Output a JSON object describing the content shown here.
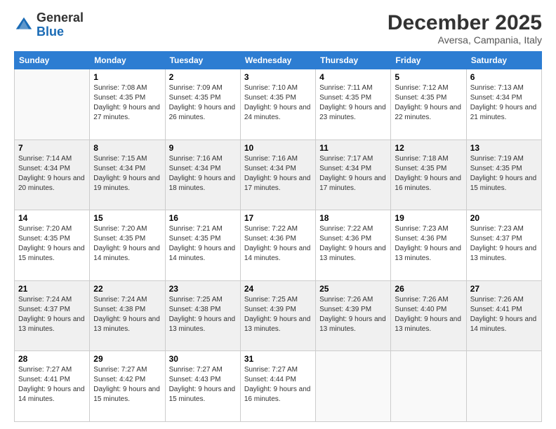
{
  "header": {
    "logo_general": "General",
    "logo_blue": "Blue",
    "month_title": "December 2025",
    "location": "Aversa, Campania, Italy"
  },
  "weekdays": [
    "Sunday",
    "Monday",
    "Tuesday",
    "Wednesday",
    "Thursday",
    "Friday",
    "Saturday"
  ],
  "weeks": [
    [
      {
        "day": null
      },
      {
        "day": 1,
        "sunrise": "7:08 AM",
        "sunset": "4:35 PM",
        "daylight": "9 hours and 27 minutes."
      },
      {
        "day": 2,
        "sunrise": "7:09 AM",
        "sunset": "4:35 PM",
        "daylight": "9 hours and 26 minutes."
      },
      {
        "day": 3,
        "sunrise": "7:10 AM",
        "sunset": "4:35 PM",
        "daylight": "9 hours and 24 minutes."
      },
      {
        "day": 4,
        "sunrise": "7:11 AM",
        "sunset": "4:35 PM",
        "daylight": "9 hours and 23 minutes."
      },
      {
        "day": 5,
        "sunrise": "7:12 AM",
        "sunset": "4:35 PM",
        "daylight": "9 hours and 22 minutes."
      },
      {
        "day": 6,
        "sunrise": "7:13 AM",
        "sunset": "4:34 PM",
        "daylight": "9 hours and 21 minutes."
      }
    ],
    [
      {
        "day": 7,
        "sunrise": "7:14 AM",
        "sunset": "4:34 PM",
        "daylight": "9 hours and 20 minutes."
      },
      {
        "day": 8,
        "sunrise": "7:15 AM",
        "sunset": "4:34 PM",
        "daylight": "9 hours and 19 minutes."
      },
      {
        "day": 9,
        "sunrise": "7:16 AM",
        "sunset": "4:34 PM",
        "daylight": "9 hours and 18 minutes."
      },
      {
        "day": 10,
        "sunrise": "7:16 AM",
        "sunset": "4:34 PM",
        "daylight": "9 hours and 17 minutes."
      },
      {
        "day": 11,
        "sunrise": "7:17 AM",
        "sunset": "4:34 PM",
        "daylight": "9 hours and 17 minutes."
      },
      {
        "day": 12,
        "sunrise": "7:18 AM",
        "sunset": "4:35 PM",
        "daylight": "9 hours and 16 minutes."
      },
      {
        "day": 13,
        "sunrise": "7:19 AM",
        "sunset": "4:35 PM",
        "daylight": "9 hours and 15 minutes."
      }
    ],
    [
      {
        "day": 14,
        "sunrise": "7:20 AM",
        "sunset": "4:35 PM",
        "daylight": "9 hours and 15 minutes."
      },
      {
        "day": 15,
        "sunrise": "7:20 AM",
        "sunset": "4:35 PM",
        "daylight": "9 hours and 14 minutes."
      },
      {
        "day": 16,
        "sunrise": "7:21 AM",
        "sunset": "4:35 PM",
        "daylight": "9 hours and 14 minutes."
      },
      {
        "day": 17,
        "sunrise": "7:22 AM",
        "sunset": "4:36 PM",
        "daylight": "9 hours and 14 minutes."
      },
      {
        "day": 18,
        "sunrise": "7:22 AM",
        "sunset": "4:36 PM",
        "daylight": "9 hours and 13 minutes."
      },
      {
        "day": 19,
        "sunrise": "7:23 AM",
        "sunset": "4:36 PM",
        "daylight": "9 hours and 13 minutes."
      },
      {
        "day": 20,
        "sunrise": "7:23 AM",
        "sunset": "4:37 PM",
        "daylight": "9 hours and 13 minutes."
      }
    ],
    [
      {
        "day": 21,
        "sunrise": "7:24 AM",
        "sunset": "4:37 PM",
        "daylight": "9 hours and 13 minutes."
      },
      {
        "day": 22,
        "sunrise": "7:24 AM",
        "sunset": "4:38 PM",
        "daylight": "9 hours and 13 minutes."
      },
      {
        "day": 23,
        "sunrise": "7:25 AM",
        "sunset": "4:38 PM",
        "daylight": "9 hours and 13 minutes."
      },
      {
        "day": 24,
        "sunrise": "7:25 AM",
        "sunset": "4:39 PM",
        "daylight": "9 hours and 13 minutes."
      },
      {
        "day": 25,
        "sunrise": "7:26 AM",
        "sunset": "4:39 PM",
        "daylight": "9 hours and 13 minutes."
      },
      {
        "day": 26,
        "sunrise": "7:26 AM",
        "sunset": "4:40 PM",
        "daylight": "9 hours and 13 minutes."
      },
      {
        "day": 27,
        "sunrise": "7:26 AM",
        "sunset": "4:41 PM",
        "daylight": "9 hours and 14 minutes."
      }
    ],
    [
      {
        "day": 28,
        "sunrise": "7:27 AM",
        "sunset": "4:41 PM",
        "daylight": "9 hours and 14 minutes."
      },
      {
        "day": 29,
        "sunrise": "7:27 AM",
        "sunset": "4:42 PM",
        "daylight": "9 hours and 15 minutes."
      },
      {
        "day": 30,
        "sunrise": "7:27 AM",
        "sunset": "4:43 PM",
        "daylight": "9 hours and 15 minutes."
      },
      {
        "day": 31,
        "sunrise": "7:27 AM",
        "sunset": "4:44 PM",
        "daylight": "9 hours and 16 minutes."
      },
      {
        "day": null
      },
      {
        "day": null
      },
      {
        "day": null
      }
    ]
  ]
}
